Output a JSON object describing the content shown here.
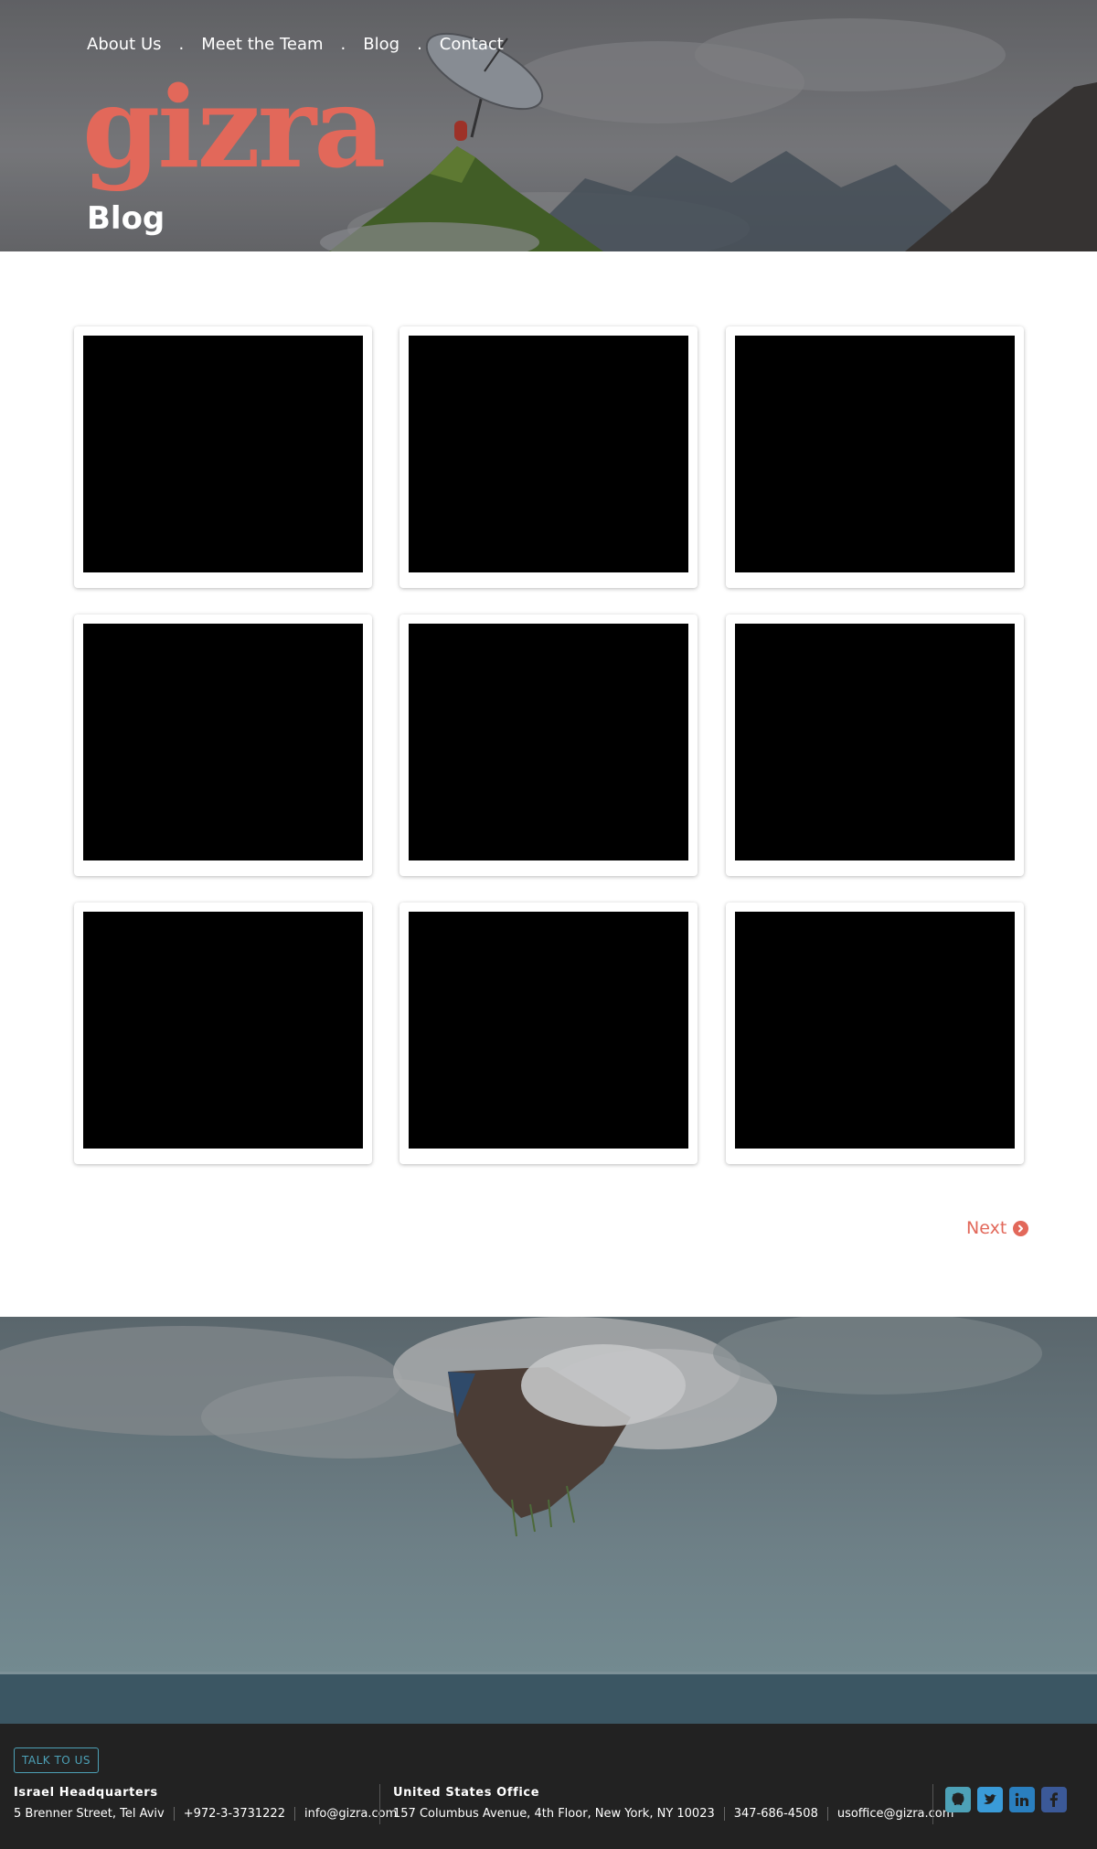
{
  "nav": {
    "items": [
      "About Us",
      "Meet the Team",
      "Blog",
      "Contact"
    ],
    "separator": "."
  },
  "brand": {
    "logo_text": "gizra",
    "color": "#e2685a"
  },
  "page": {
    "title": "Blog"
  },
  "grid": {
    "card_count": 9
  },
  "pagination": {
    "next_label": "Next",
    "icon": "chevron-circle-right-icon"
  },
  "footer": {
    "talk_button": "TALK TO US",
    "israel": {
      "title": "Israel Headquarters",
      "address": "5 Brenner Street, Tel Aviv",
      "phone": "+972-3-3731222",
      "email": "info@gizra.com"
    },
    "us": {
      "title": "United States Office",
      "address": "157 Columbus Avenue, 4th Floor, New York, NY 10023",
      "phone": "347-686-4508",
      "email": "usoffice@gizra.com"
    },
    "social": [
      {
        "name": "github-icon",
        "color": "#4da1b7"
      },
      {
        "name": "twitter-icon",
        "color": "#3a9bd8"
      },
      {
        "name": "linkedin-icon",
        "color": "#2a7fbf"
      },
      {
        "name": "facebook-icon",
        "color": "#3b5998"
      }
    ]
  },
  "colors": {
    "accent": "#e2685a",
    "footer_bg": "#222222",
    "talk_border": "#4da1b7"
  }
}
